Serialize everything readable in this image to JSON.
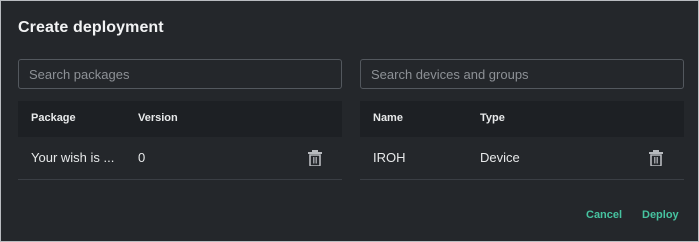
{
  "dialog": {
    "title": "Create deployment",
    "cancel_label": "Cancel",
    "deploy_label": "Deploy"
  },
  "packages": {
    "search_placeholder": "Search packages",
    "columns": [
      "Package",
      "Version"
    ],
    "rows": [
      {
        "package": "Your wish is ...",
        "version": "0"
      }
    ]
  },
  "devices": {
    "search_placeholder": "Search devices and groups",
    "columns": [
      "Name",
      "Type"
    ],
    "rows": [
      {
        "name": "IROH",
        "type": "Device"
      }
    ]
  },
  "colors": {
    "background": "#24272b",
    "table_header": "#1d2024",
    "accent": "#46c3a0"
  },
  "icons": {
    "row_action": "trash-icon"
  }
}
